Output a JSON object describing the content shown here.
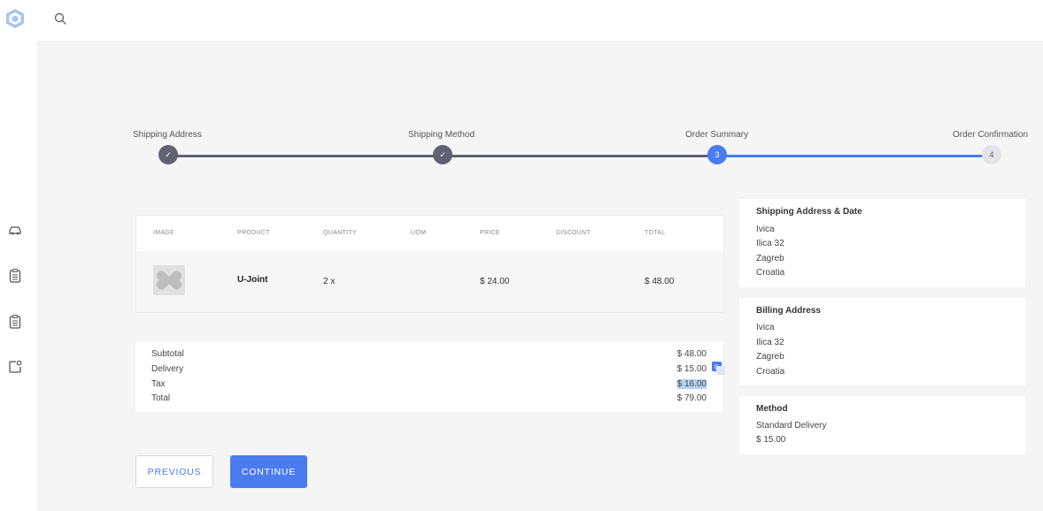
{
  "stepper": {
    "steps": [
      {
        "label": "Shipping Address",
        "marker": "✓",
        "state": "done"
      },
      {
        "label": "Shipping Method",
        "marker": "✓",
        "state": "done"
      },
      {
        "label": "Order Summary",
        "marker": "3",
        "state": "active"
      },
      {
        "label": "Order Confirmation",
        "marker": "4",
        "state": "pending"
      }
    ]
  },
  "table": {
    "headers": [
      "IMAGE",
      "PRODUCT",
      "QUANTITY",
      "UOM",
      "PRICE",
      "DISCOUNT",
      "TOTAL"
    ],
    "rows": [
      {
        "product": "U-Joint",
        "quantity": "2  x",
        "uom": "",
        "price": "$ 24.00",
        "discount": "",
        "total": "$ 48.00"
      }
    ]
  },
  "totals": [
    {
      "label": "Subtotal",
      "value": "$ 48.00"
    },
    {
      "label": "Delivery",
      "value": "$ 15.00"
    },
    {
      "label": "Tax",
      "value": "$ 16.00"
    },
    {
      "label": "Total",
      "value": "$ 79.00"
    }
  ],
  "shipping": {
    "title": "Shipping Address & Date",
    "lines": [
      "Ivica",
      "Ilica 32",
      "Zagreb",
      "Croatia"
    ]
  },
  "billing": {
    "title": "Billing Address",
    "lines": [
      "Ivica",
      "Ilica 32",
      "Zagreb",
      "Croatia"
    ]
  },
  "method": {
    "title": "Method",
    "lines": [
      "Standard Delivery",
      "$ 15.00"
    ]
  },
  "buttons": {
    "previous": "PREVIOUS",
    "continue": "CONTINUE"
  },
  "icons": {
    "logo": "hexagon-logo-icon",
    "search": "search-icon",
    "sidebar": [
      "car-icon",
      "clipboard-icon",
      "clipboard-icon",
      "gear-box-icon"
    ],
    "translate": "translate-icon"
  },
  "colors": {
    "accent": "#4a7cf0",
    "done": "#616173",
    "pending": "#e4e4e8",
    "background": "#f5f5f6"
  }
}
